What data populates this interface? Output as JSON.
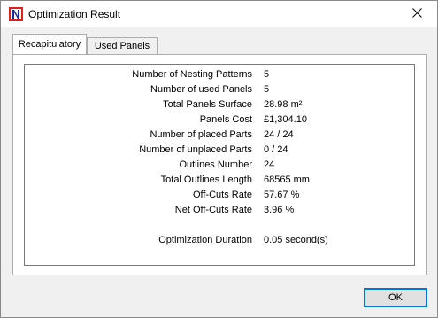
{
  "window": {
    "title": "Optimization Result",
    "icon": "app-logo-icon",
    "close_icon": "close-icon"
  },
  "tabs": [
    {
      "label": "Recapitulatory",
      "active": true
    },
    {
      "label": "Used Panels",
      "active": false
    }
  ],
  "summary": {
    "rows": [
      {
        "label": "Number of Nesting Patterns",
        "value": "5"
      },
      {
        "label": "Number of used Panels",
        "value": "5"
      },
      {
        "label": "Total Panels Surface",
        "value": "28.98 m²"
      },
      {
        "label": "Panels Cost",
        "value": "£1,304.10"
      },
      {
        "label": "Number of placed Parts",
        "value": "24 / 24"
      },
      {
        "label": "Number of unplaced Parts",
        "value": "0 / 24"
      },
      {
        "label": "Outlines Number",
        "value": "24"
      },
      {
        "label": "Total Outlines Length",
        "value": "68565 mm"
      },
      {
        "label": "Off-Cuts Rate",
        "value": "57.67 %"
      },
      {
        "label": "Net Off-Cuts Rate",
        "value": "3.96 %"
      }
    ],
    "duration": {
      "label": "Optimization Duration",
      "value": "0.05 second(s)"
    }
  },
  "buttons": {
    "ok_label": "OK"
  },
  "colors": {
    "accent": "#0078d7",
    "logo_red": "#e01e1e",
    "logo_blue": "#1a2a9c"
  }
}
